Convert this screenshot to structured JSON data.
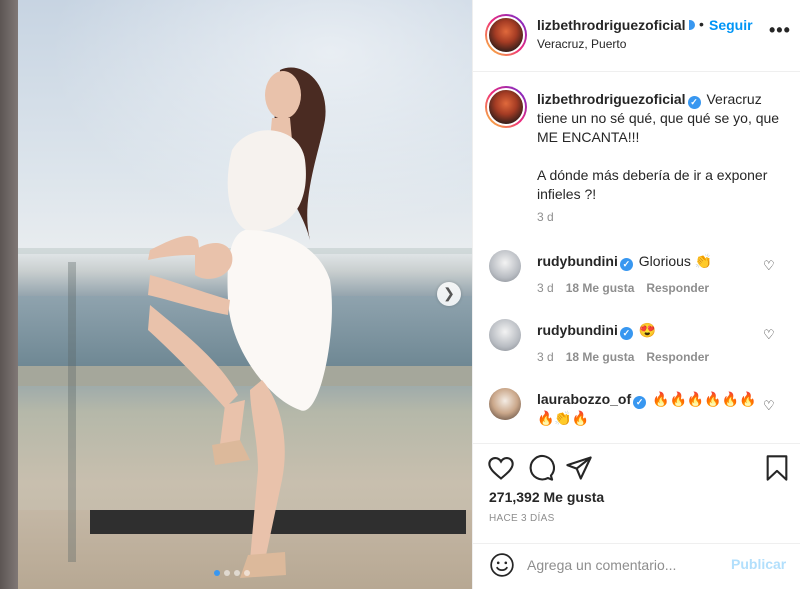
{
  "post": {
    "image_alt": "",
    "carousel": {
      "dot_count": 4,
      "active_index": 0
    }
  },
  "header": {
    "username": "lizbethrodriguezoficial",
    "follow_label": "Seguir",
    "bullet": "•",
    "location": "Veracruz, Puerto",
    "more_label": "•••"
  },
  "caption": {
    "username": "lizbethrodriguezoficial",
    "text_line1": "Veracruz tiene un no sé qué, que qué se yo, que ME ENCANTA!!!",
    "text_line2": "A dónde más debería de ir a exponer infieles ?!",
    "time": "3 d"
  },
  "comments": [
    {
      "username": "rudybundini",
      "text": "Glorious 👏",
      "time": "3 d",
      "likes": "18 Me gusta",
      "reply": "Responder"
    },
    {
      "username": "rudybundini",
      "text": "😍",
      "time": "3 d",
      "likes": "18 Me gusta",
      "reply": "Responder"
    },
    {
      "username": "laurabozzo_of",
      "text": "🔥🔥🔥🔥🔥🔥🔥👏🔥",
      "time": "",
      "likes": "",
      "reply": ""
    }
  ],
  "actions": {
    "likes": "271,392 Me gusta",
    "ago": "HACE 3 DÍAS"
  },
  "add_comment": {
    "placeholder": "Agrega un comentario...",
    "publish_label": "Publicar"
  },
  "colors": {
    "accent": "#0095f6",
    "verified": "#3897f0",
    "muted": "#8e8e8e",
    "publish_disabled": "#b2dffc"
  }
}
